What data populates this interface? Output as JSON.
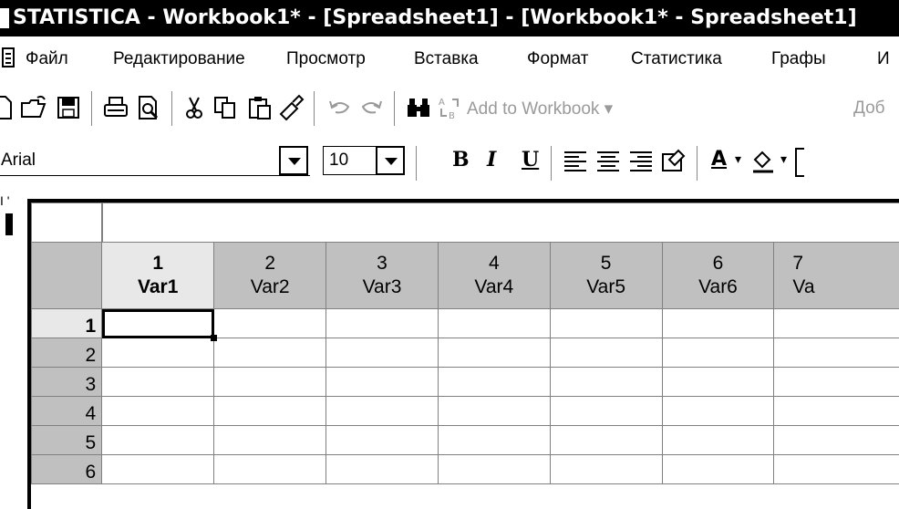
{
  "window": {
    "title": "STATISTICA - Workbook1* - [Spreadsheet1] - [Workbook1* - Spreadsheet1]"
  },
  "menubar": {
    "items": [
      "Файл",
      "Редактирование",
      "Просмотр",
      "Вставка",
      "Формат",
      "Статистика",
      "Графы",
      "И"
    ]
  },
  "toolbar": {
    "icons": [
      "new-document-icon",
      "open-folder-icon",
      "save-icon",
      "print-icon",
      "print-preview-icon",
      "cut-icon",
      "copy-icon",
      "paste-icon",
      "format-painter-icon",
      "undo-icon",
      "redo-icon",
      "find-binoculars-icon",
      "replace-icon"
    ],
    "add_to_workbook": "Add to Workbook ▾",
    "add_to_report_partial": "Доб"
  },
  "formatbar": {
    "font_name": "Arial",
    "font_size": "10",
    "bold": "B",
    "italic": "I",
    "underline": "U",
    "font_color_letter": "A"
  },
  "sheet": {
    "side_marks": "I '",
    "columns": [
      {
        "num": "1",
        "name": "Var1"
      },
      {
        "num": "2",
        "name": "Var2"
      },
      {
        "num": "3",
        "name": "Var3"
      },
      {
        "num": "4",
        "name": "Var4"
      },
      {
        "num": "5",
        "name": "Var5"
      },
      {
        "num": "6",
        "name": "Var6"
      },
      {
        "num": "7",
        "name": "Va"
      }
    ],
    "rows": [
      "1",
      "2",
      "3",
      "4",
      "5",
      "6"
    ],
    "active_cell": {
      "row": "1",
      "col": "1"
    }
  }
}
